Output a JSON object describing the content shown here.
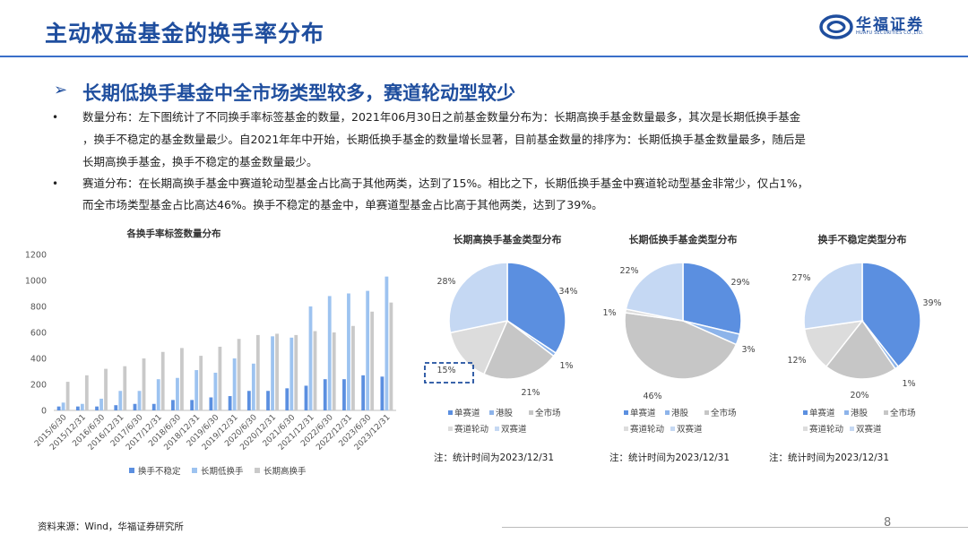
{
  "header": {
    "title": "主动权益基金的换手率分布",
    "logo_name": "华福证券",
    "logo_sub": "HUAFU SECURITIES CO.,LTD."
  },
  "headline": {
    "arrow": "➢",
    "text": "长期低换手基金中全市场类型较多，赛道轮动型较少"
  },
  "bullets": [
    {
      "dot": "•",
      "lines": [
        "数量分布：左下图统计了不同换手率标签基金的数量，2021年06月30日之前基金数量分布为：长期高换手基金数量最多，其次是长期低换手基金",
        "，换手不稳定的基金数量最少。自2021年年中开始，长期低换手基金的数量增长显著，目前基金数量的排序为：长期低换手基金数量最多，随后是",
        "长期高换手基金，换手不稳定的基金数量最少。"
      ]
    },
    {
      "dot": "•",
      "lines": [
        "赛道分布：在长期高换手基金中赛道轮动型基金占比高于其他两类，达到了15%。相比之下，长期低换手基金中赛道轮动型基金非常少，仅占1%，",
        "而全市场类型基金占比高达46%。换手不稳定的基金中，单赛道型基金占比高于其他两类，达到了39%。"
      ]
    }
  ],
  "chart_data": [
    {
      "type": "bar",
      "title": "各换手率标签数量分布",
      "categories": [
        "2015/6/30",
        "2015/12/31",
        "2016/6/30",
        "2016/12/31",
        "2017/6/30",
        "2017/12/31",
        "2018/6/30",
        "2018/12/31",
        "2019/6/30",
        "2019/12/31",
        "2020/6/30",
        "2020/12/31",
        "2021/6/30",
        "2021/12/31",
        "2022/6/30",
        "2022/12/31",
        "2023/6/30",
        "2023/12/31"
      ],
      "series": [
        {
          "name": "换手不稳定",
          "color": "#5b8fe0",
          "values": [
            30,
            30,
            30,
            40,
            50,
            50,
            80,
            80,
            100,
            110,
            150,
            150,
            170,
            190,
            240,
            240,
            270,
            260
          ]
        },
        {
          "name": "长期低换手",
          "color": "#9dc3f0",
          "values": [
            60,
            50,
            90,
            150,
            150,
            240,
            250,
            310,
            290,
            400,
            360,
            570,
            560,
            800,
            880,
            900,
            920,
            1030
          ]
        },
        {
          "name": "长期高换手",
          "color": "#c9c9c9",
          "values": [
            220,
            270,
            320,
            340,
            400,
            450,
            480,
            420,
            490,
            550,
            580,
            590,
            580,
            610,
            600,
            650,
            760,
            830
          ]
        }
      ],
      "ylim": [
        0,
        1200
      ],
      "yticks": [
        0,
        200,
        400,
        600,
        800,
        1000,
        1200
      ],
      "legend_position": "bottom"
    },
    {
      "type": "pie",
      "title": "长期高换手基金类型分布",
      "slices": [
        {
          "name": "单赛道",
          "value": 34,
          "label": "34%",
          "color": "#5b8fe0"
        },
        {
          "name": "港股",
          "value": 1,
          "label": "1%",
          "color": "#8db4ea"
        },
        {
          "name": "全市场",
          "value": 21,
          "label": "21%",
          "color": "#c6c6c6"
        },
        {
          "name": "赛道轮动",
          "value": 15,
          "label": "15%",
          "color": "#dcdcdc"
        },
        {
          "name": "双赛道",
          "value": 28,
          "label": "28%",
          "color": "#c5d8f3"
        }
      ],
      "highlight": "15%",
      "legend_position": "bottom",
      "note": "注：统计时间为2023/12/31"
    },
    {
      "type": "pie",
      "title": "长期低换手基金类型分布",
      "slices": [
        {
          "name": "单赛道",
          "value": 29,
          "label": "29%",
          "color": "#5b8fe0"
        },
        {
          "name": "港股",
          "value": 3,
          "label": "3%",
          "color": "#8db4ea"
        },
        {
          "name": "全市场",
          "value": 46,
          "label": "46%",
          "color": "#c6c6c6"
        },
        {
          "name": "赛道轮动",
          "value": 1,
          "label": "1%",
          "color": "#dcdcdc"
        },
        {
          "name": "双赛道",
          "value": 22,
          "label": "22%",
          "color": "#c5d8f3"
        }
      ],
      "legend_position": "bottom",
      "note": "注：统计时间为2023/12/31"
    },
    {
      "type": "pie",
      "title": "换手不稳定类型分布",
      "slices": [
        {
          "name": "单赛道",
          "value": 39,
          "label": "39%",
          "color": "#5b8fe0"
        },
        {
          "name": "港股",
          "value": 1,
          "label": "1%",
          "color": "#8db4ea"
        },
        {
          "name": "全市场",
          "value": 20,
          "label": "20%",
          "color": "#c6c6c6"
        },
        {
          "name": "赛道轮动",
          "value": 12,
          "label": "12%",
          "color": "#dcdcdc"
        },
        {
          "name": "双赛道",
          "value": 27,
          "label": "27%",
          "color": "#c5d8f3"
        }
      ],
      "legend_position": "bottom",
      "note": "注：统计时间为2023/12/31"
    }
  ],
  "footer": {
    "source": "资料来源：Wind，华福证券研究所",
    "page_number": "8"
  },
  "colors": {
    "brand": "#1f4e9e",
    "rule": "#3a6fc9"
  }
}
